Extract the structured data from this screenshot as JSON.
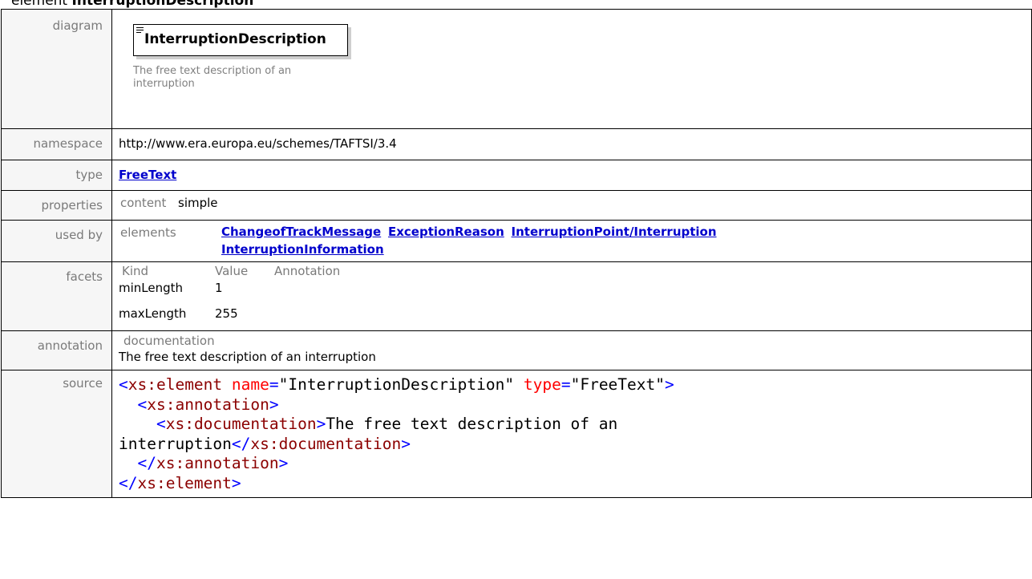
{
  "heading": {
    "prefix": "element",
    "name": "InterruptionDescription"
  },
  "labels": {
    "diagram": "diagram",
    "namespace": "namespace",
    "type": "type",
    "properties": "properties",
    "used_by": "used by",
    "facets": "facets",
    "annotation": "annotation",
    "source": "source"
  },
  "diagram": {
    "element_name": "InterruptionDescription",
    "documentation": "The free text description of an interruption"
  },
  "namespace": "http://www.era.europa.eu/schemes/TAFTSI/3.4",
  "type": "FreeText",
  "properties": {
    "label": "content",
    "value": "simple"
  },
  "used_by": {
    "label": "elements",
    "links": [
      "ChangeofTrackMessage",
      "ExceptionReason",
      "InterruptionPoint/Interruption",
      "InterruptionInformation"
    ]
  },
  "facets": {
    "headers": [
      "Kind",
      "Value",
      "Annotation"
    ],
    "rows": [
      {
        "kind": "minLength",
        "value": "1"
      },
      {
        "kind": "maxLength",
        "value": "255"
      }
    ]
  },
  "annotation": {
    "label": "documentation",
    "text": "The free text description of an interruption"
  },
  "source": {
    "element_tag": "xs:element",
    "attr_name": "name",
    "attr_name_value": "\"InterruptionDescription\"",
    "attr_type": "type",
    "attr_type_value": "\"FreeText\"",
    "annotation_tag": "xs:annotation",
    "documentation_tag": "xs:documentation",
    "doc_text_line1": "The free text description of an",
    "doc_text_line2": "interruption"
  },
  "colors": {
    "link": "#0000cc",
    "tag": "#8b0000",
    "bracket": "#0000ff",
    "attr": "#ff0000",
    "label_bg": "#f6f6f6"
  }
}
